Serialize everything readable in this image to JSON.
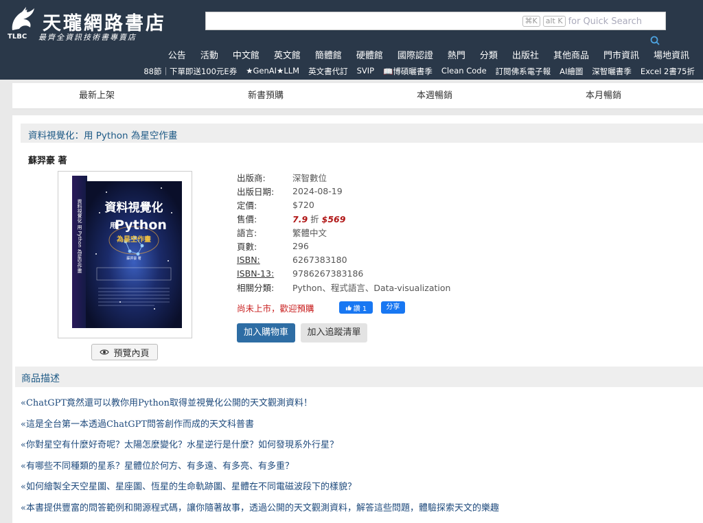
{
  "header": {
    "logo_title": "天瓏網路書店",
    "logo_sub": "最齊全資訊技術書專賣店",
    "logo_badge": "TLBC",
    "search": {
      "placeholder": "",
      "hint_key1": "⌘K",
      "hint_key2": "alt K",
      "hint_for": "for",
      "hint_text": "Quick Search"
    },
    "main_nav": [
      "公告",
      "活動",
      "中文館",
      "英文館",
      "簡體館",
      "硬體館",
      "國際認證",
      "熱門",
      "分類",
      "出版社",
      "其他商品",
      "門市資訊",
      "場地資訊"
    ],
    "sub_nav": [
      "88節｜下單即送100元E券",
      "★GenAI★LLM",
      "英文書代訂",
      "SVIP",
      "📖博碩曬書季",
      "Clean Code",
      "訂閱佛系電子報",
      "AI繪圖",
      "深智曬書季",
      "Excel 2書75折"
    ]
  },
  "tabs": [
    "最新上架",
    "新書預購",
    "本週暢銷",
    "本月暢銷"
  ],
  "product": {
    "title": "資料視覺化：用 Python 為星空作畫",
    "author": "蘇羿豪 著",
    "cover": {
      "title1": "資料視覺化",
      "title2_prefix": "用",
      "title2_main": "Python",
      "title3": "為星空作畫",
      "author": "蘇羿豪 著",
      "spine": "資料視覺化 用 Python 為星空作畫"
    },
    "preview_label": "預覽內頁",
    "info": [
      {
        "label": "出版商:",
        "value": "深智數位"
      },
      {
        "label": "出版日期:",
        "value": "2024-08-19"
      },
      {
        "label": "定價:",
        "value": "$720"
      },
      {
        "label": "售價:",
        "discount": "7.9",
        "discount_unit": "折",
        "price": "$569"
      },
      {
        "label": "語言:",
        "value": "繁體中文"
      },
      {
        "label": "頁數:",
        "value": "296"
      },
      {
        "label": "ISBN:",
        "value": "6267383180"
      },
      {
        "label": "ISBN-13:",
        "value": "9786267383186"
      },
      {
        "label": "相關分類:",
        "value": "Python、程式語言、Data-visualization"
      }
    ],
    "presale_text": "尚未上市，歡迎預購",
    "fb_like": "讚 1",
    "fb_share": "分享",
    "cart_button": "加入購物車",
    "track_button": "加入追蹤清單"
  },
  "description": {
    "heading": "商品描述",
    "items": [
      "«ChatGPT竟然還可以教你用Python取得並視覺化公開的天文觀測資料！",
      "«這是全台第一本透過ChatGPT問答創作而成的天文科普書",
      "«你對星空有什麼好奇呢？太陽怎麼變化？水星逆行是什麼？如何發現系外行星？",
      "«有哪些不同種類的星系？星體位於何方、有多遠、有多亮、有多重？",
      "«如何繪製全天空星圖、星座圖、恆星的生命軌跡圖、星體在不同電磁波段下的樣貌？",
      "«本書提供豐富的問答範例和開源程式碼，讓你隨著故事，透過公開的天文觀測資料，解答這些問題，體驗探索天文的樂趣"
    ]
  },
  "colors": {
    "header_bg": "#2a3849",
    "link_blue": "#1e5a86",
    "price_red": "#b01616",
    "cart_blue": "#2e6da4",
    "fb_blue": "#1877f2"
  }
}
